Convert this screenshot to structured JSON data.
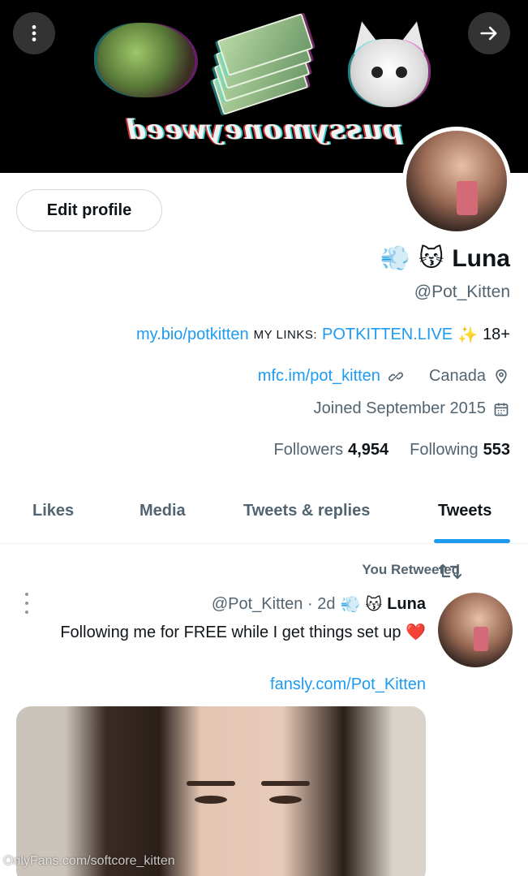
{
  "banner": {
    "text": "pussymoneyweed",
    "more_icon": "more-vertical-icon",
    "arrow_icon": "arrow-right-icon"
  },
  "profile": {
    "edit_label": "Edit profile",
    "name": "Luna",
    "name_emojis": [
      "😽",
      "💨"
    ],
    "handle": "@Pot_Kitten",
    "bio": {
      "age": "18+",
      "sparkle": "✨",
      "site": "POTKITTEN.LIVE",
      "links_label": "MY LINKS:",
      "links_url": "my.bio/potkitten"
    },
    "location": "Canada",
    "website": "mfc.im/pot_kitten",
    "joined": "Joined September 2015",
    "following_count": "553",
    "following_label": "Following",
    "followers_count": "4,954",
    "followers_label": "Followers"
  },
  "tabs": [
    {
      "label": "Tweets",
      "active": true
    },
    {
      "label": "Tweets & replies",
      "active": false
    },
    {
      "label": "Media",
      "active": false
    },
    {
      "label": "Likes",
      "active": false
    }
  ],
  "tweet": {
    "retweet_label": "You Retweeted",
    "author_name": "Luna",
    "author_emojis": [
      "😽",
      "💨"
    ],
    "handle_time": "@Pot_Kitten · 2d",
    "text": "Following me for FREE while I get things set up",
    "heart": "❤️",
    "link": "fansly.com/Pot_Kitten"
  },
  "watermark": "OnlyFans.com/softcore_kitten",
  "colors": {
    "accent": "#1d9bf0",
    "text": "#0f1419",
    "muted": "#536471"
  }
}
